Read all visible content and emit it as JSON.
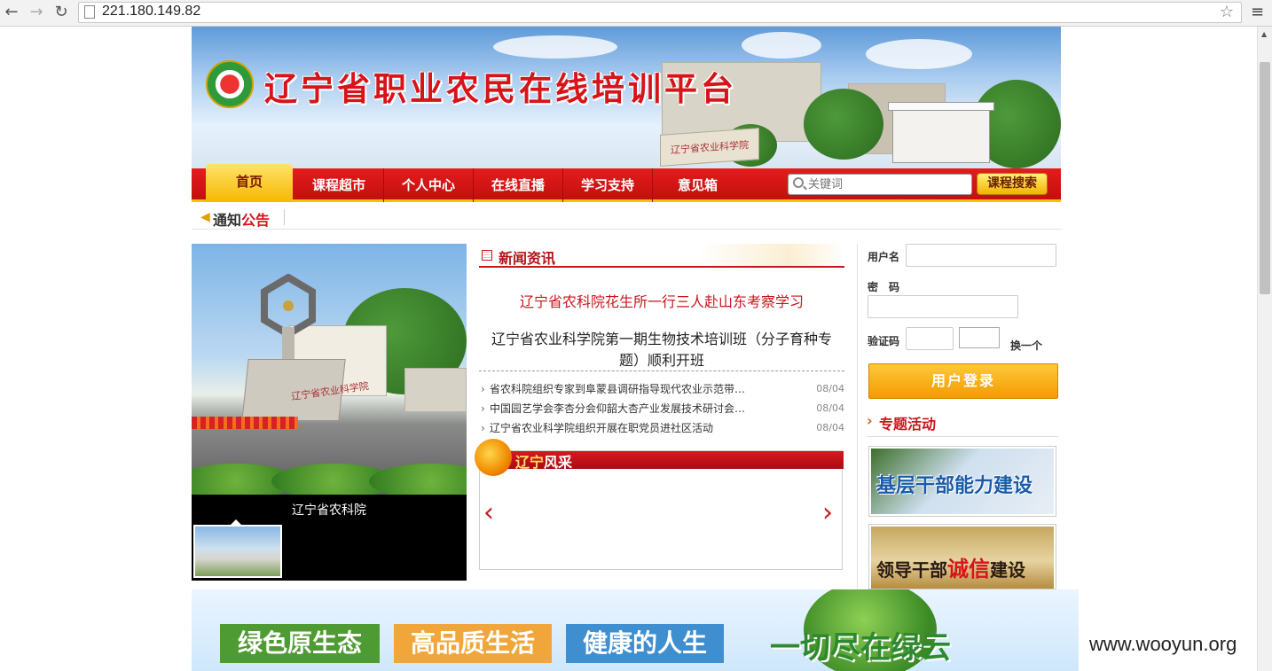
{
  "browser": {
    "url": "221.180.149.82"
  },
  "site": {
    "title": "辽宁省职业农民在线培训平台",
    "gate_sign": "辽宁省农业科学院"
  },
  "nav": {
    "items": [
      "首页",
      "课程超市",
      "个人中心",
      "在线直播",
      "学习支持",
      "意见箱"
    ],
    "search_placeholder": "关键词",
    "search_button": "课程搜索"
  },
  "notice": {
    "label_a": "通知",
    "label_b": "公告"
  },
  "slideshow": {
    "caption": "辽宁省农科院",
    "monument_text": "辽宁省农业科学院"
  },
  "news": {
    "heading": "新闻资讯",
    "headline_primary": "辽宁省农科院花生所一行三人赴山东考察学习",
    "headline_secondary": "辽宁省农业科学院第一期生物技术培训班（分子育种专题）顺利开班",
    "items": [
      {
        "title": "省农科院组织专家到阜蒙县调研指导现代农业示范带…",
        "date": "08/04"
      },
      {
        "title": "中国园艺学会李杏分会仰韶大杏产业发展技术研讨会…",
        "date": "08/04"
      },
      {
        "title": "辽宁省农业科学院组织开展在职党员进社区活动",
        "date": "08/04"
      }
    ]
  },
  "fengcai": {
    "title_a": "辽宁",
    "title_b": "风采",
    "prev": "‹",
    "next": "›"
  },
  "login": {
    "username_label": "用户名",
    "password_label": "密　码",
    "captcha_label": "验证码",
    "refresh_label": "换一个",
    "login_button": "用户登录"
  },
  "topics": {
    "heading": "专题活动",
    "promo1": "基层干部能力建设",
    "promo2_a": "领导干部",
    "promo2_b": "诚信",
    "promo2_c": "建设"
  },
  "ad": {
    "box1": "绿色原生态",
    "box2": "高品质生活",
    "box3": "健康的人生",
    "slogan": "一切尽在绿云",
    "colors": [
      "#4f9b33",
      "#f0a63a",
      "#3f8ecf"
    ]
  },
  "watermark": "www.wooyun.org"
}
